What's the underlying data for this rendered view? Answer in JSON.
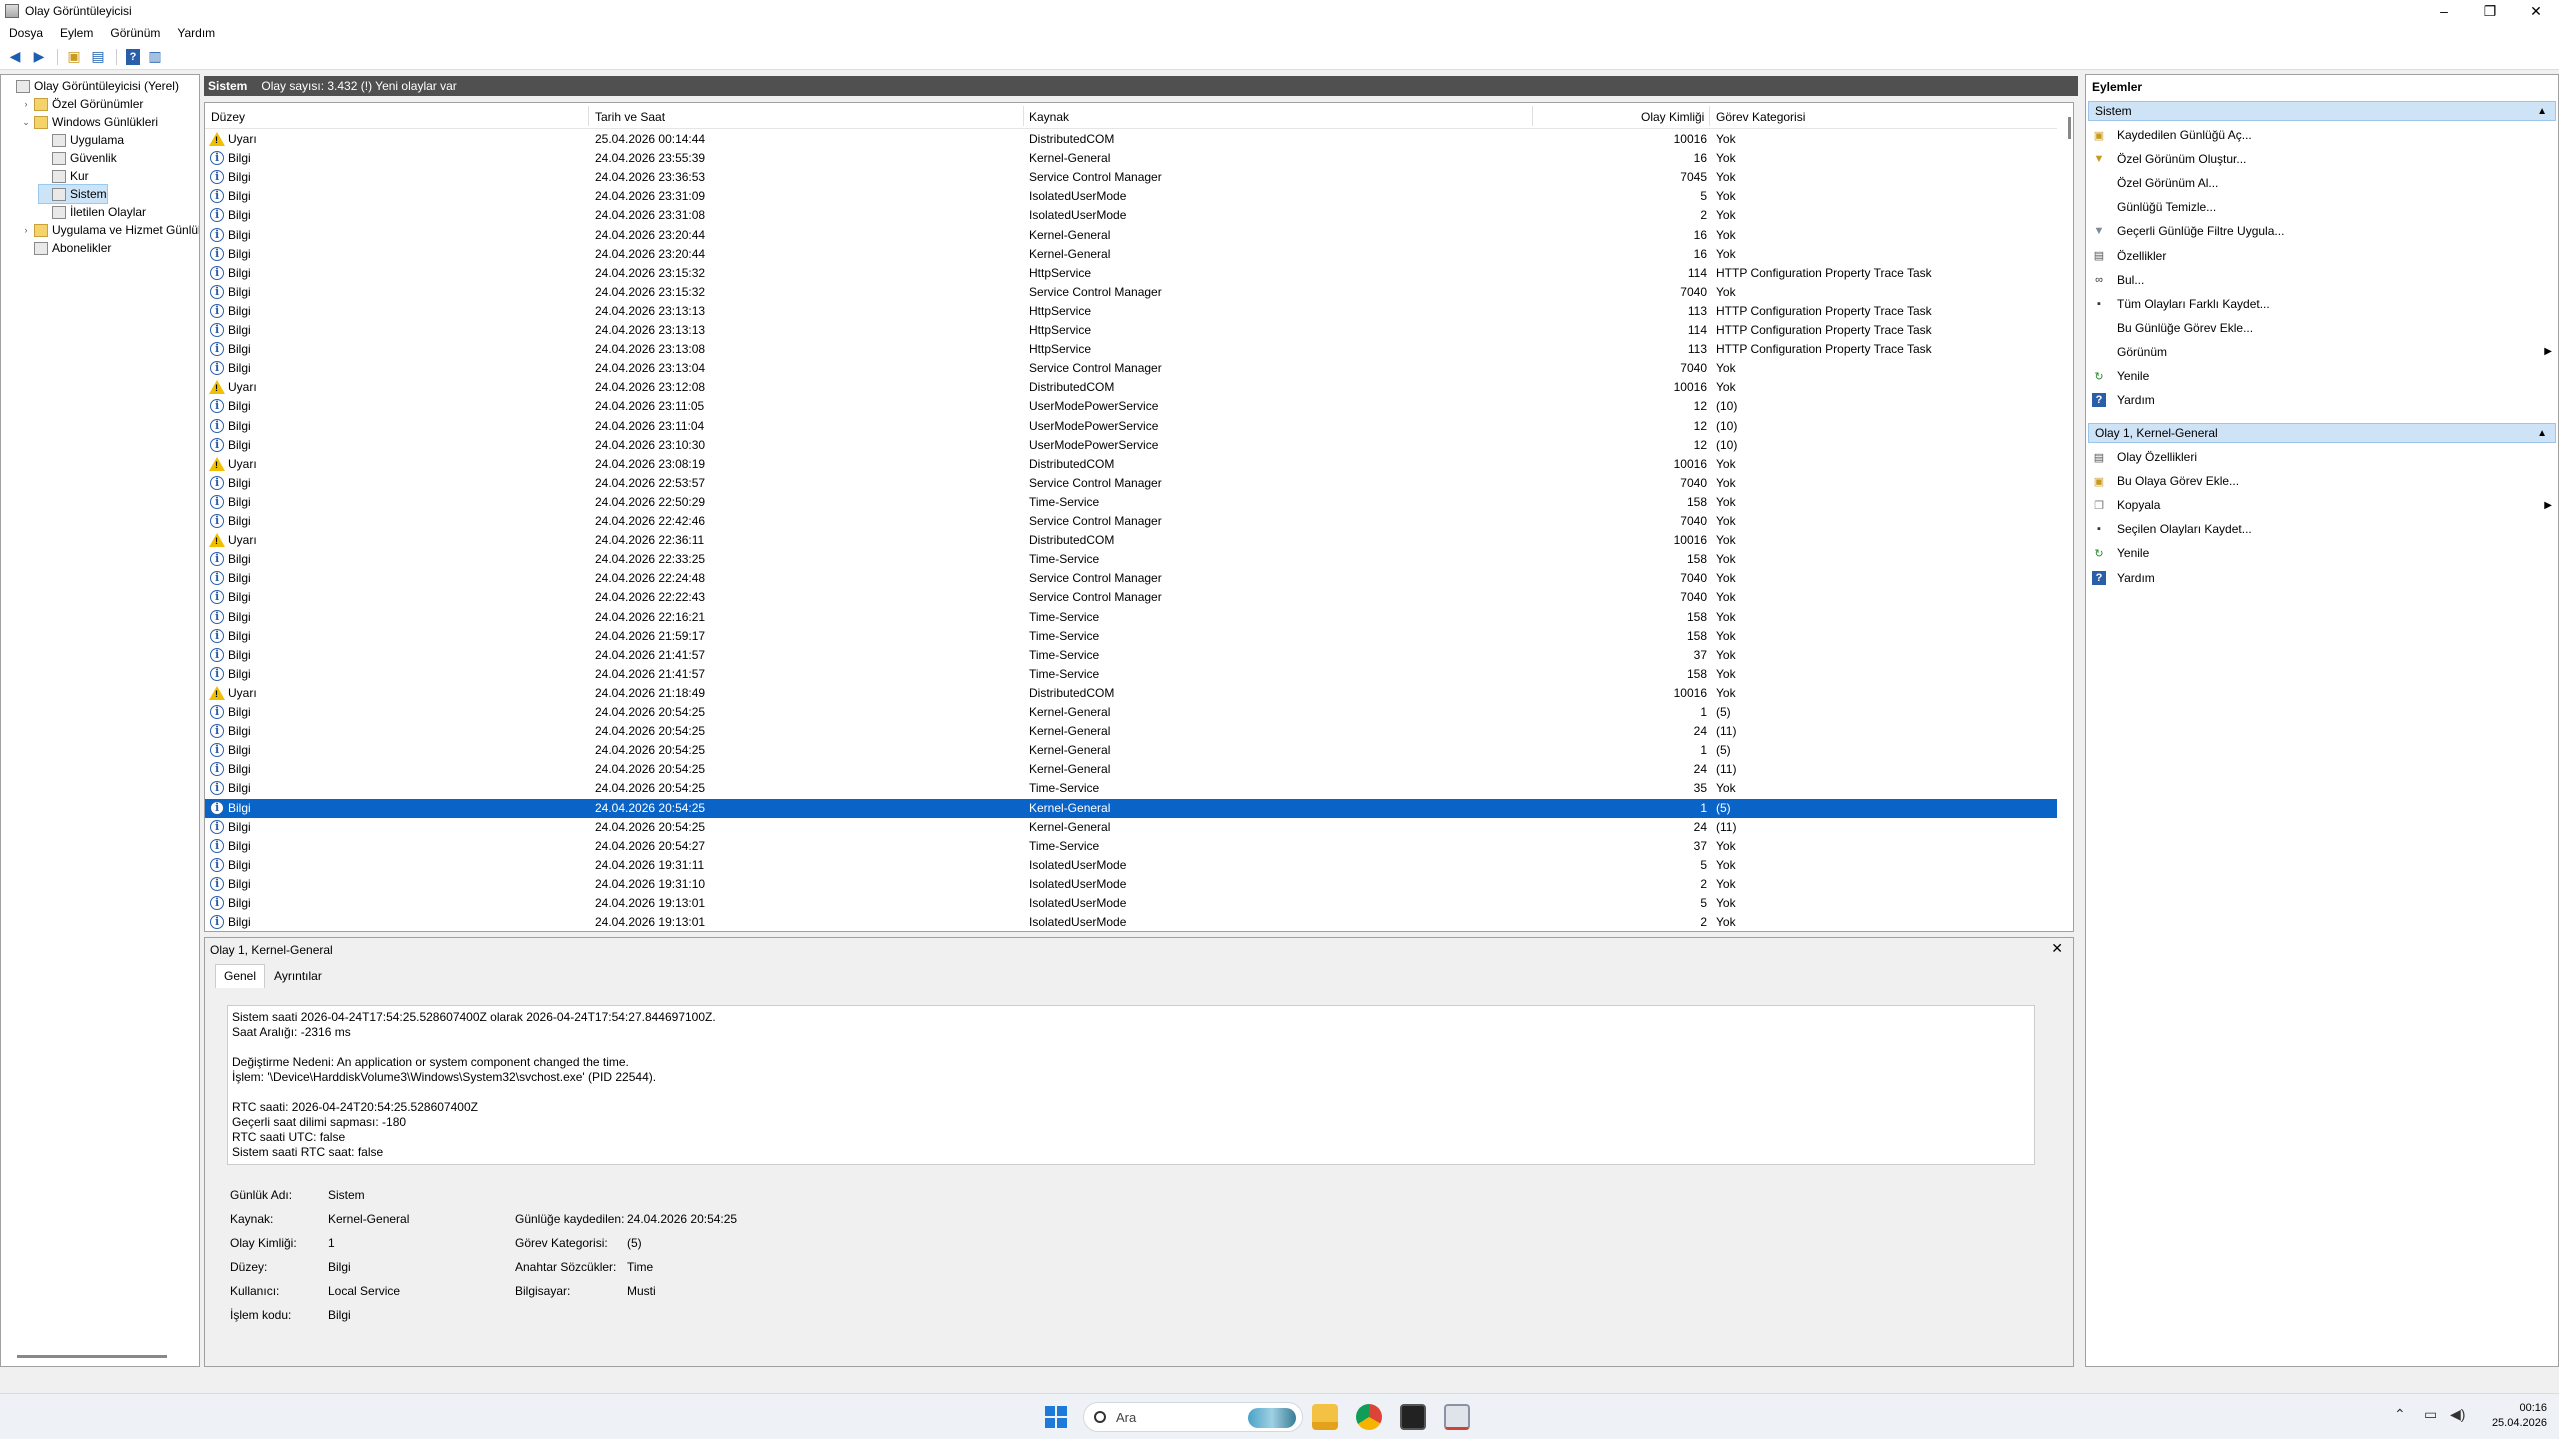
{
  "window": {
    "title": "Olay Görüntüleyicisi",
    "controls": [
      "–",
      "❐",
      "✕"
    ]
  },
  "menu": [
    "Dosya",
    "Eylem",
    "Görünüm",
    "Yardım"
  ],
  "toolbar": [
    "back-icon",
    "forward-icon",
    "up-folder-icon",
    "show-hide-tree-icon",
    "help-icon",
    "show-hide-action-pane-icon"
  ],
  "tree": [
    {
      "label": "Olay Görüntüleyicisi (Yerel)",
      "level": 0,
      "expander": "",
      "icon": "event-viewer-icon"
    },
    {
      "label": "Özel Görünümler",
      "level": 1,
      "expander": "›",
      "icon": "folder-icon"
    },
    {
      "label": "Windows Günlükleri",
      "level": 1,
      "expander": "⌄",
      "icon": "folder-icon"
    },
    {
      "label": "Uygulama",
      "level": 2,
      "expander": "",
      "icon": "log-icon"
    },
    {
      "label": "Güvenlik",
      "level": 2,
      "expander": "",
      "icon": "log-icon"
    },
    {
      "label": "Kur",
      "level": 2,
      "expander": "",
      "icon": "log-icon"
    },
    {
      "label": "Sistem",
      "level": 2,
      "expander": "",
      "icon": "log-icon",
      "selected": true
    },
    {
      "label": "İletilen Olaylar",
      "level": 2,
      "expander": "",
      "icon": "log-icon"
    },
    {
      "label": "Uygulama ve Hizmet Günlük",
      "level": 1,
      "expander": "›",
      "icon": "folder-icon"
    },
    {
      "label": "Abonelikler",
      "level": 1,
      "expander": "",
      "icon": "subscription-icon"
    }
  ],
  "center": {
    "header_title": "Sistem",
    "header_info": "Olay sayısı: 3.432 (!) Yeni olaylar var",
    "columns": [
      "Düzey",
      "Tarih ve Saat",
      "Kaynak",
      "Olay Kimliği",
      "Görev Kategorisi"
    ],
    "rows": [
      {
        "type": "warn",
        "level": "Uyarı",
        "date": "25.04.2026 00:14:44",
        "source": "DistributedCOM",
        "id": "10016",
        "cat": "Yok"
      },
      {
        "type": "info",
        "level": "Bilgi",
        "date": "24.04.2026 23:55:39",
        "source": "Kernel-General",
        "id": "16",
        "cat": "Yok"
      },
      {
        "type": "info",
        "level": "Bilgi",
        "date": "24.04.2026 23:36:53",
        "source": "Service Control Manager",
        "id": "7045",
        "cat": "Yok"
      },
      {
        "type": "info",
        "level": "Bilgi",
        "date": "24.04.2026 23:31:09",
        "source": "IsolatedUserMode",
        "id": "5",
        "cat": "Yok"
      },
      {
        "type": "info",
        "level": "Bilgi",
        "date": "24.04.2026 23:31:08",
        "source": "IsolatedUserMode",
        "id": "2",
        "cat": "Yok"
      },
      {
        "type": "info",
        "level": "Bilgi",
        "date": "24.04.2026 23:20:44",
        "source": "Kernel-General",
        "id": "16",
        "cat": "Yok"
      },
      {
        "type": "info",
        "level": "Bilgi",
        "date": "24.04.2026 23:20:44",
        "source": "Kernel-General",
        "id": "16",
        "cat": "Yok"
      },
      {
        "type": "info",
        "level": "Bilgi",
        "date": "24.04.2026 23:15:32",
        "source": "HttpService",
        "id": "114",
        "cat": "HTTP Configuration Property Trace Task"
      },
      {
        "type": "info",
        "level": "Bilgi",
        "date": "24.04.2026 23:15:32",
        "source": "Service Control Manager",
        "id": "7040",
        "cat": "Yok"
      },
      {
        "type": "info",
        "level": "Bilgi",
        "date": "24.04.2026 23:13:13",
        "source": "HttpService",
        "id": "113",
        "cat": "HTTP Configuration Property Trace Task"
      },
      {
        "type": "info",
        "level": "Bilgi",
        "date": "24.04.2026 23:13:13",
        "source": "HttpService",
        "id": "114",
        "cat": "HTTP Configuration Property Trace Task"
      },
      {
        "type": "info",
        "level": "Bilgi",
        "date": "24.04.2026 23:13:08",
        "source": "HttpService",
        "id": "113",
        "cat": "HTTP Configuration Property Trace Task"
      },
      {
        "type": "info",
        "level": "Bilgi",
        "date": "24.04.2026 23:13:04",
        "source": "Service Control Manager",
        "id": "7040",
        "cat": "Yok"
      },
      {
        "type": "warn",
        "level": "Uyarı",
        "date": "24.04.2026 23:12:08",
        "source": "DistributedCOM",
        "id": "10016",
        "cat": "Yok"
      },
      {
        "type": "info",
        "level": "Bilgi",
        "date": "24.04.2026 23:11:05",
        "source": "UserModePowerService",
        "id": "12",
        "cat": "(10)"
      },
      {
        "type": "info",
        "level": "Bilgi",
        "date": "24.04.2026 23:11:04",
        "source": "UserModePowerService",
        "id": "12",
        "cat": "(10)"
      },
      {
        "type": "info",
        "level": "Bilgi",
        "date": "24.04.2026 23:10:30",
        "source": "UserModePowerService",
        "id": "12",
        "cat": "(10)"
      },
      {
        "type": "warn",
        "level": "Uyarı",
        "date": "24.04.2026 23:08:19",
        "source": "DistributedCOM",
        "id": "10016",
        "cat": "Yok"
      },
      {
        "type": "info",
        "level": "Bilgi",
        "date": "24.04.2026 22:53:57",
        "source": "Service Control Manager",
        "id": "7040",
        "cat": "Yok"
      },
      {
        "type": "info",
        "level": "Bilgi",
        "date": "24.04.2026 22:50:29",
        "source": "Time-Service",
        "id": "158",
        "cat": "Yok"
      },
      {
        "type": "info",
        "level": "Bilgi",
        "date": "24.04.2026 22:42:46",
        "source": "Service Control Manager",
        "id": "7040",
        "cat": "Yok"
      },
      {
        "type": "warn",
        "level": "Uyarı",
        "date": "24.04.2026 22:36:11",
        "source": "DistributedCOM",
        "id": "10016",
        "cat": "Yok"
      },
      {
        "type": "info",
        "level": "Bilgi",
        "date": "24.04.2026 22:33:25",
        "source": "Time-Service",
        "id": "158",
        "cat": "Yok"
      },
      {
        "type": "info",
        "level": "Bilgi",
        "date": "24.04.2026 22:24:48",
        "source": "Service Control Manager",
        "id": "7040",
        "cat": "Yok"
      },
      {
        "type": "info",
        "level": "Bilgi",
        "date": "24.04.2026 22:22:43",
        "source": "Service Control Manager",
        "id": "7040",
        "cat": "Yok"
      },
      {
        "type": "info",
        "level": "Bilgi",
        "date": "24.04.2026 22:16:21",
        "source": "Time-Service",
        "id": "158",
        "cat": "Yok"
      },
      {
        "type": "info",
        "level": "Bilgi",
        "date": "24.04.2026 21:59:17",
        "source": "Time-Service",
        "id": "158",
        "cat": "Yok"
      },
      {
        "type": "info",
        "level": "Bilgi",
        "date": "24.04.2026 21:41:57",
        "source": "Time-Service",
        "id": "37",
        "cat": "Yok"
      },
      {
        "type": "info",
        "level": "Bilgi",
        "date": "24.04.2026 21:41:57",
        "source": "Time-Service",
        "id": "158",
        "cat": "Yok"
      },
      {
        "type": "warn",
        "level": "Uyarı",
        "date": "24.04.2026 21:18:49",
        "source": "DistributedCOM",
        "id": "10016",
        "cat": "Yok"
      },
      {
        "type": "info",
        "level": "Bilgi",
        "date": "24.04.2026 20:54:25",
        "source": "Kernel-General",
        "id": "1",
        "cat": "(5)"
      },
      {
        "type": "info",
        "level": "Bilgi",
        "date": "24.04.2026 20:54:25",
        "source": "Kernel-General",
        "id": "24",
        "cat": "(11)"
      },
      {
        "type": "info",
        "level": "Bilgi",
        "date": "24.04.2026 20:54:25",
        "source": "Kernel-General",
        "id": "1",
        "cat": "(5)"
      },
      {
        "type": "info",
        "level": "Bilgi",
        "date": "24.04.2026 20:54:25",
        "source": "Kernel-General",
        "id": "24",
        "cat": "(11)"
      },
      {
        "type": "info",
        "level": "Bilgi",
        "date": "24.04.2026 20:54:25",
        "source": "Time-Service",
        "id": "35",
        "cat": "Yok"
      },
      {
        "type": "info",
        "level": "Bilgi",
        "date": "24.04.2026 20:54:25",
        "source": "Kernel-General",
        "id": "1",
        "cat": "(5)",
        "selected": true
      },
      {
        "type": "info",
        "level": "Bilgi",
        "date": "24.04.2026 20:54:25",
        "source": "Kernel-General",
        "id": "24",
        "cat": "(11)"
      },
      {
        "type": "info",
        "level": "Bilgi",
        "date": "24.04.2026 20:54:27",
        "source": "Time-Service",
        "id": "37",
        "cat": "Yok"
      },
      {
        "type": "info",
        "level": "Bilgi",
        "date": "24.04.2026 19:31:11",
        "source": "IsolatedUserMode",
        "id": "5",
        "cat": "Yok"
      },
      {
        "type": "info",
        "level": "Bilgi",
        "date": "24.04.2026 19:31:10",
        "source": "IsolatedUserMode",
        "id": "2",
        "cat": "Yok"
      },
      {
        "type": "info",
        "level": "Bilgi",
        "date": "24.04.2026 19:13:01",
        "source": "IsolatedUserMode",
        "id": "5",
        "cat": "Yok"
      },
      {
        "type": "info",
        "level": "Bilgi",
        "date": "24.04.2026 19:13:01",
        "source": "IsolatedUserMode",
        "id": "2",
        "cat": "Yok"
      }
    ]
  },
  "detail": {
    "title": "Olay 1, Kernel-General",
    "close": "✕",
    "tabs": [
      "Genel",
      "Ayrıntılar"
    ],
    "description": "Sistem saati 2026-04-24T17:54:25.528607400Z olarak 2026-04-24T17:54:27.844697100Z.\nSaat Aralığı: -2316 ms\n\nDeğiştirme Nedeni: An application or system component changed the time.\nİşlem: '\\Device\\HarddiskVolume3\\Windows\\System32\\svchost.exe' (PID 22544).\n\nRTC saati: 2026-04-24T20:54:25.528607400Z\nGeçerli saat dilimi sapması: -180\nRTC saati UTC: false\nSistem saati RTC saat: false",
    "fields": {
      "log_name_label": "Günlük Adı:",
      "log_name": "Sistem",
      "source_label": "Kaynak:",
      "source": "Kernel-General",
      "logged_label": "Günlüğe kaydedilen:",
      "logged": "24.04.2026 20:54:25",
      "event_id_label": "Olay Kimliği:",
      "event_id": "1",
      "task_label": "Görev Kategorisi:",
      "task": "(5)",
      "level_label": "Düzey:",
      "level": "Bilgi",
      "keywords_label": "Anahtar Sözcükler:",
      "keywords": "Time",
      "user_label": "Kullanıcı:",
      "user": "Local Service",
      "computer_label": "Bilgisayar:",
      "computer": "Musti",
      "opcode_label": "İşlem kodu:",
      "opcode": "Bilgi"
    }
  },
  "actions": {
    "header": "Eylemler",
    "section1": "Sistem",
    "section1_items": [
      {
        "label": "Kaydedilen Günlüğü Aç...",
        "icon": "open-log-icon"
      },
      {
        "label": "Özel Görünüm Oluştur...",
        "icon": "filter-create-icon"
      },
      {
        "label": "Özel Görünüm Al...",
        "icon": ""
      },
      {
        "label": "Günlüğü Temizle...",
        "icon": ""
      },
      {
        "label": "Geçerli Günlüğe Filtre Uygula...",
        "icon": "filter-icon"
      },
      {
        "label": "Özellikler",
        "icon": "properties-icon"
      },
      {
        "label": "Bul...",
        "icon": "binoculars-icon"
      },
      {
        "label": "Tüm Olayları Farklı Kaydet...",
        "icon": "save-icon"
      },
      {
        "label": "Bu Günlüğe Görev Ekle...",
        "icon": ""
      },
      {
        "label": "Görünüm",
        "icon": "",
        "submenu": "▶"
      },
      {
        "label": "Yenile",
        "icon": "refresh-icon"
      },
      {
        "label": "Yardım",
        "icon": "help-icon"
      }
    ],
    "section2": "Olay 1, Kernel-General",
    "section2_items": [
      {
        "label": "Olay Özellikleri",
        "icon": "event-properties-icon"
      },
      {
        "label": "Bu Olaya Görev Ekle...",
        "icon": "task-icon"
      },
      {
        "label": "Kopyala",
        "icon": "copy-icon",
        "submenu": "▶"
      },
      {
        "label": "Seçilen Olayları Kaydet...",
        "icon": "save-icon"
      },
      {
        "label": "Yenile",
        "icon": "refresh-icon"
      },
      {
        "label": "Yardım",
        "icon": "help-icon"
      }
    ]
  },
  "taskbar": {
    "search_placeholder": "Ara",
    "clock_time": "00:16",
    "clock_date": "25.04.2026",
    "apps": [
      "widgets-icon",
      "file-explorer-icon",
      "chrome-icon",
      "terminal-icon",
      "event-viewer-taskbar-icon"
    ],
    "tray": [
      "chevron-up-icon",
      "network-icon",
      "volume-icon"
    ]
  },
  "colors": {
    "selection": "#0a64c8",
    "section_header": "#cfe3f6",
    "center_header": "#505050"
  }
}
